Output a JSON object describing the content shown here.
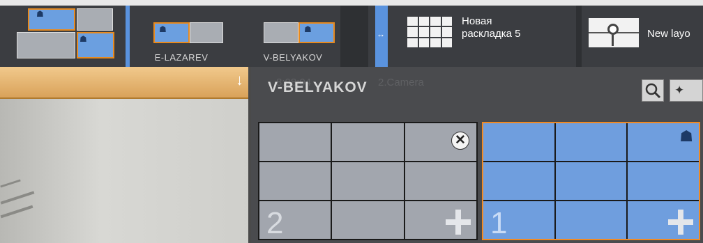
{
  "toolbar": {
    "layouts": [
      {
        "label": ""
      },
      {
        "label": "E-LAZAREV"
      },
      {
        "label": "V-BELYAKOV"
      }
    ],
    "expand_icon": "↔",
    "new_layout": {
      "label_line1": "Новая",
      "label_line2": "раскладка 5"
    },
    "new_layout_2": {
      "label": "New layo"
    }
  },
  "camera_bar": {
    "arrow": "↓",
    "ghost_time": "8:08:04",
    "ghost_camera": "2.Camera"
  },
  "popup": {
    "title": "V-BELYAKOV",
    "search_icon": "search-icon",
    "pin_icon": "pin-icon",
    "pin_glyph": "✦",
    "monitors": [
      {
        "number": "2",
        "selected": false,
        "close_glyph": "✕"
      },
      {
        "number": "1",
        "selected": true
      }
    ]
  },
  "colors": {
    "accent_blue": "#6f9ede",
    "accent_orange": "#f08a24",
    "toolbar_bg": "#3b3d41"
  }
}
